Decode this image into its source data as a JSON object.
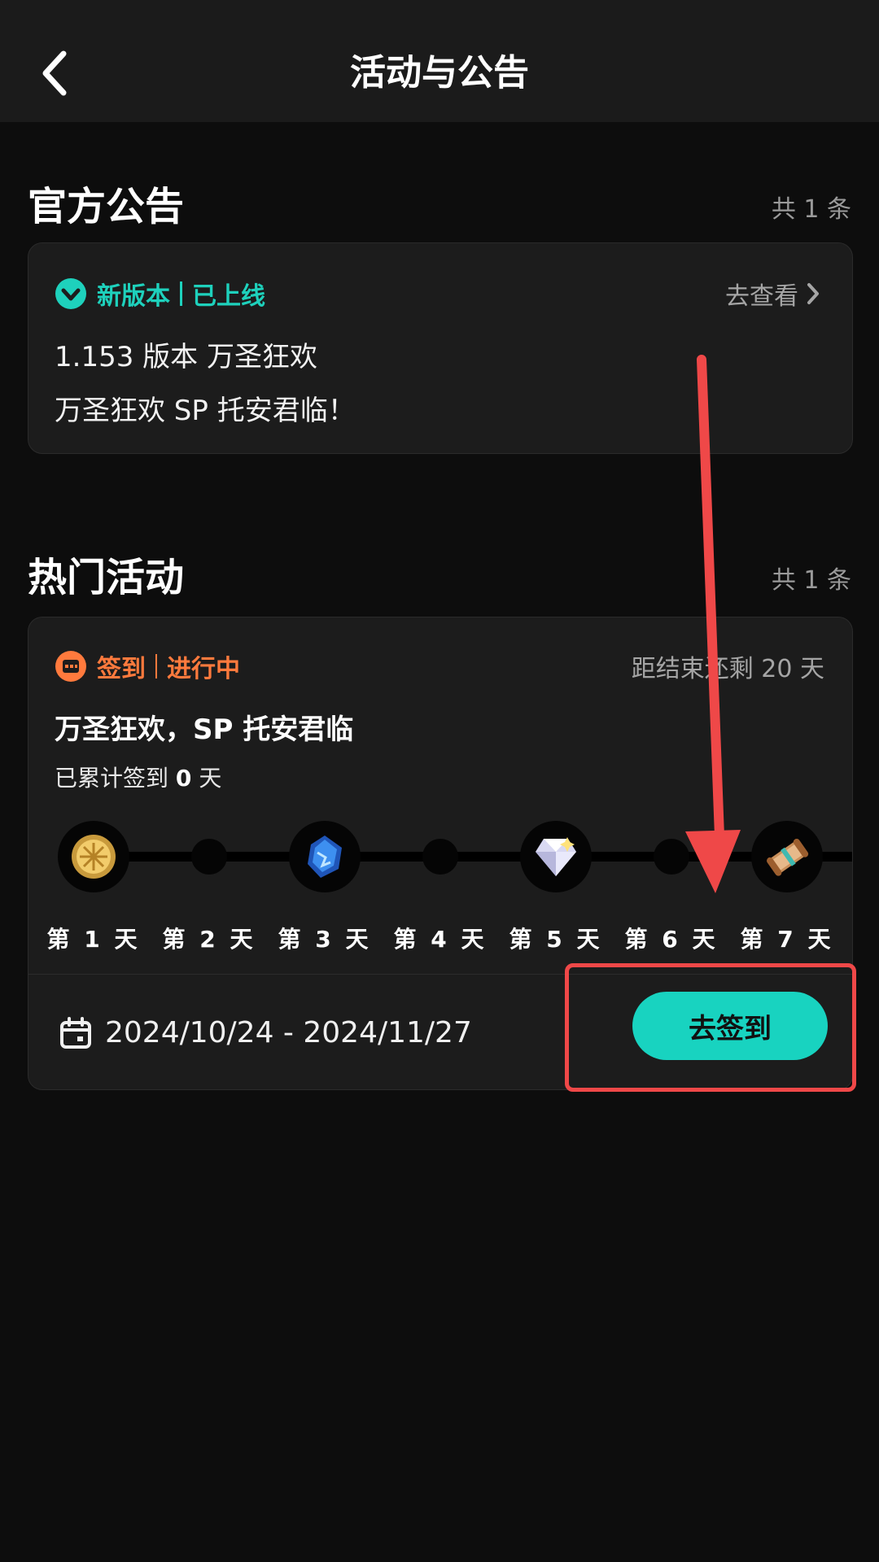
{
  "header": {
    "title": "活动与公告",
    "back_icon": "chevron-left-icon"
  },
  "announcements": {
    "title": "官方公告",
    "count": "共 1 条",
    "card": {
      "tag_icon": "heart-badge-icon",
      "tag_text": "新版本",
      "status_text": "已上线",
      "link_text": "去查看",
      "lines": [
        "1.153 版本 万圣狂欢",
        "万圣狂欢 SP 托安君临！"
      ]
    }
  },
  "activities": {
    "title": "热门活动",
    "count": "共 1 条",
    "card": {
      "tag_icon": "calendar-stamp-icon",
      "tag_text": "签到",
      "status_text": "进行中",
      "remaining": "距结束还剩 20 天",
      "title": "万圣狂欢，SP 托安君临",
      "progress_prefix": "已累计签到",
      "progress_value": "0",
      "progress_suffix": "天",
      "days": [
        {
          "label": "第 1 天",
          "reward_icon": "gold-coin-icon"
        },
        {
          "label": "第 2 天"
        },
        {
          "label": "第 3 天",
          "reward_icon": "blue-crystal-icon"
        },
        {
          "label": "第 4 天"
        },
        {
          "label": "第 5 天",
          "reward_icon": "white-gem-icon"
        },
        {
          "label": "第 6 天"
        },
        {
          "label": "第 7 天",
          "reward_icon": "scroll-icon"
        }
      ],
      "date_range": "2024/10/24 - 2024/11/27",
      "button": "去签到"
    }
  },
  "colors": {
    "accent_teal": "#18d3c0",
    "accent_orange": "#ff7a3d",
    "annotation_red": "#ef4848"
  }
}
